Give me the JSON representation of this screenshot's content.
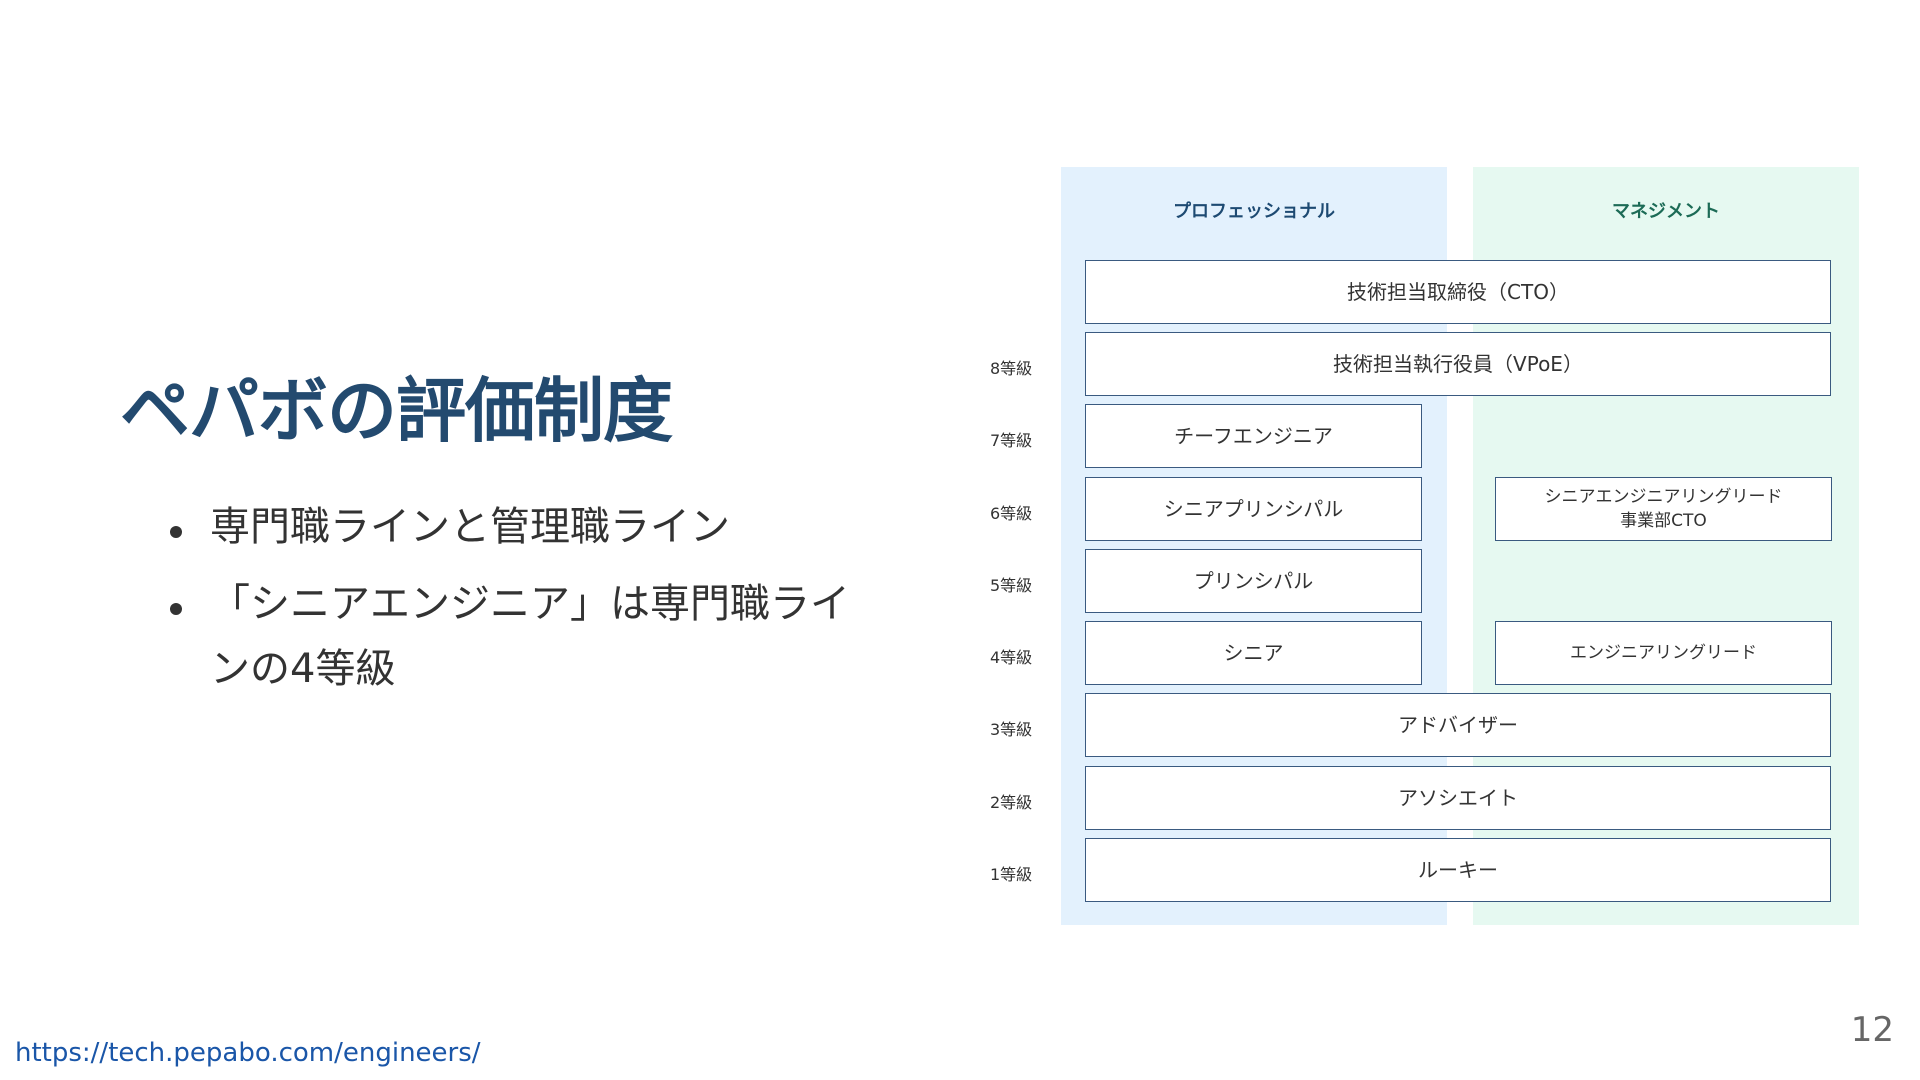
{
  "slide": {
    "title": "ペパボの評価制度",
    "bullets": [
      "専門職ラインと管理職ライン",
      "「シニアエンジニア」は専門職ラインの4等級"
    ],
    "footer_url": "https://tech.pepabo.com/engineers/",
    "page_number": "12"
  },
  "ladder": {
    "professional_header": "プロフェッショナル",
    "management_header": "マネジメント",
    "grades": [
      "8等級",
      "7等級",
      "6等級",
      "5等級",
      "4等級",
      "3等級",
      "2等級",
      "1等級"
    ],
    "roles": {
      "cto": "技術担当取締役（CTO）",
      "vpoe": "技術担当執行役員（VPoE）",
      "chief_engineer": "チーフエンジニア",
      "senior_principal": "シニアプリンシパル",
      "senior_engineering_lead": "シニアエンジニアリングリード",
      "division_cto": "事業部CTO",
      "principal": "プリンシパル",
      "senior": "シニア",
      "engineering_lead": "エンジニアリングリード",
      "advisor": "アドバイザー",
      "associate": "アソシエイト",
      "rookie": "ルーキー"
    }
  }
}
